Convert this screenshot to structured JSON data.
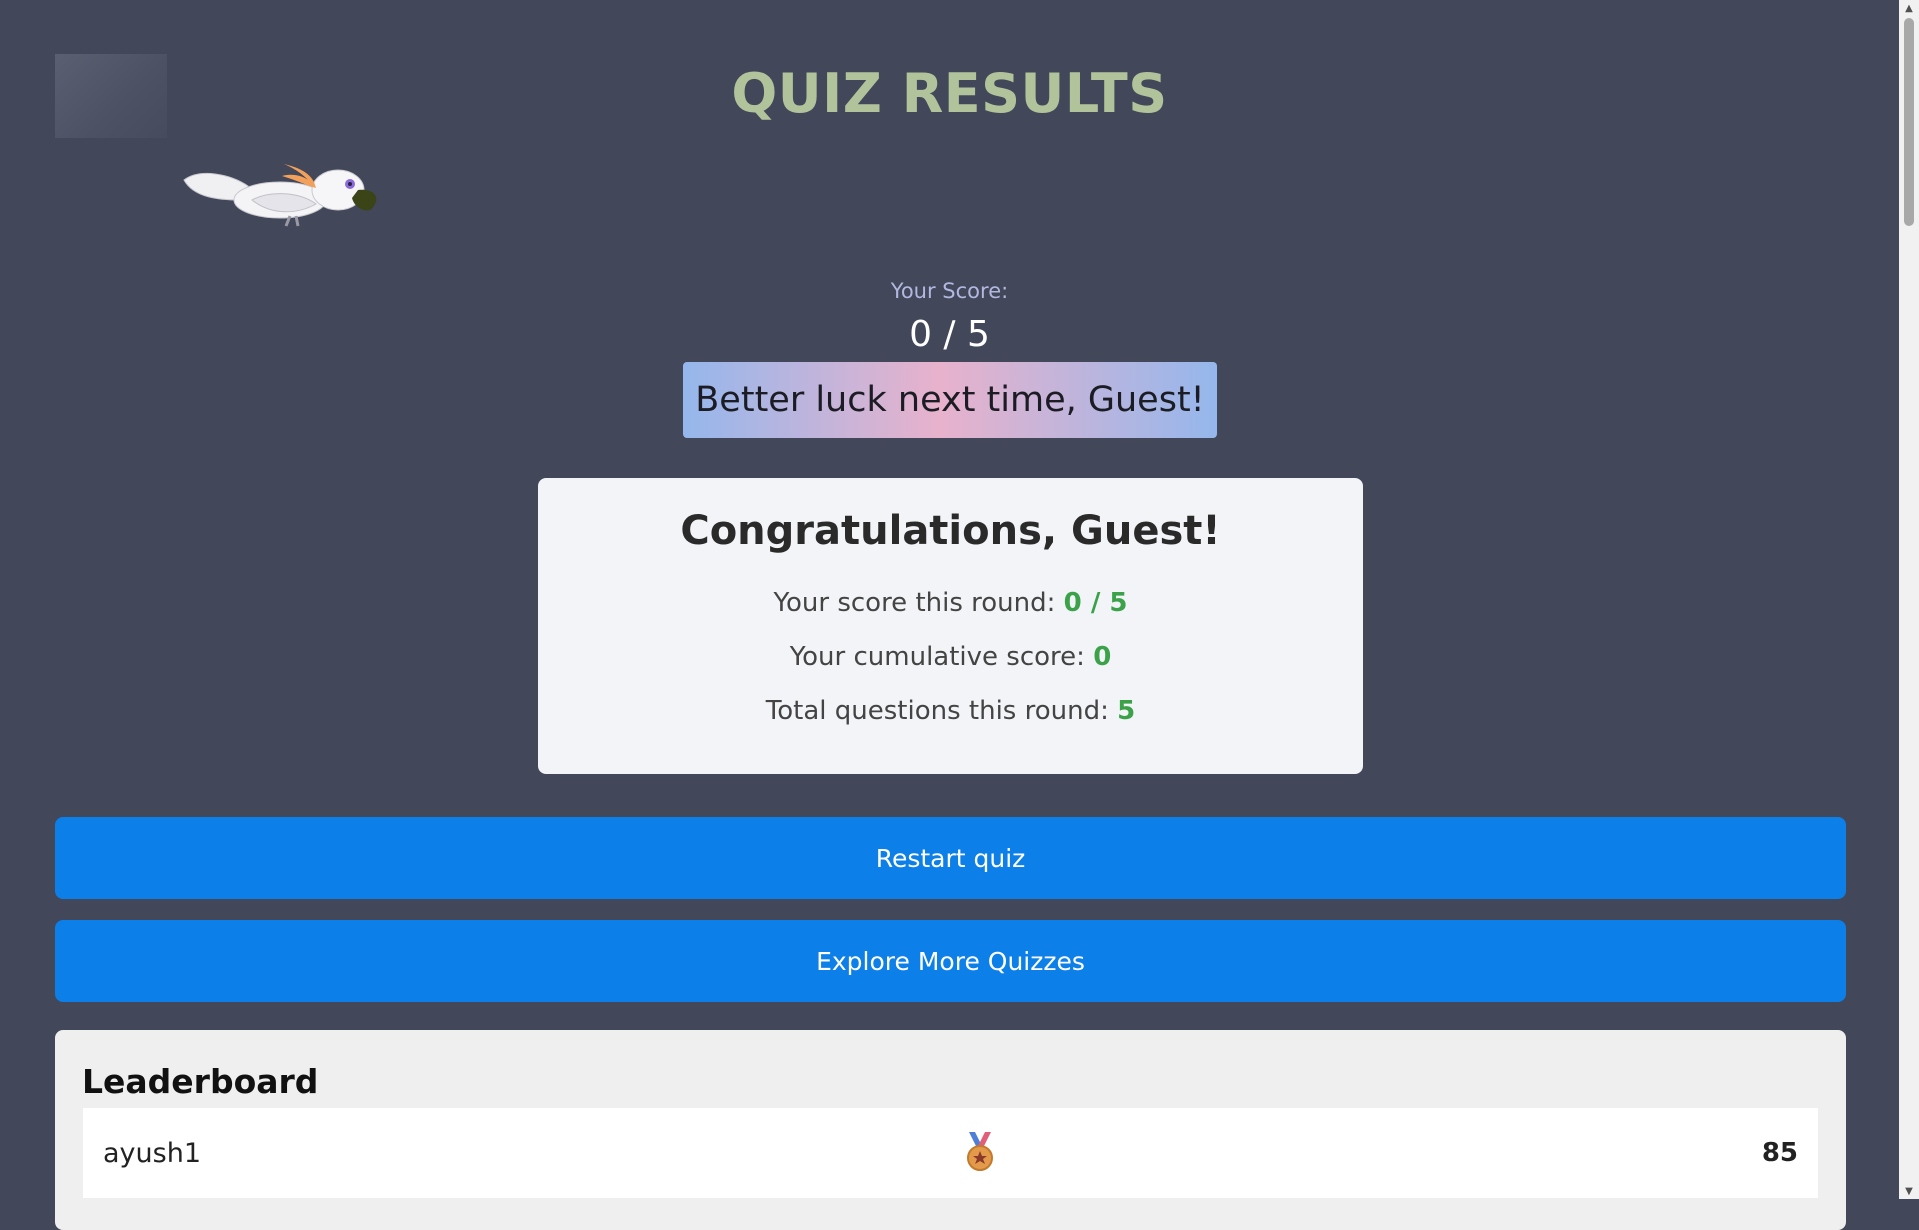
{
  "header": {
    "title": "QUIZ RESULTS"
  },
  "score": {
    "label": "Your Score:",
    "value": "0 / 5",
    "message": "Better luck next time, Guest!"
  },
  "summary": {
    "title": "Congratulations, Guest!",
    "round_label": "Your score this round: ",
    "round_value": "0 / 5",
    "cumulative_label": "Your cumulative score: ",
    "cumulative_value": "0",
    "total_label": "Total questions this round: ",
    "total_value": "5"
  },
  "buttons": {
    "restart": "Restart quiz",
    "explore": "Explore More Quizzes"
  },
  "leaderboard": {
    "title": "Leaderboard",
    "entries": [
      {
        "name": "ayush1",
        "medal": "medal-icon",
        "score": "85"
      }
    ]
  },
  "colors": {
    "background": "#424759",
    "title": "#b1c39a",
    "button": "#0c7fe8",
    "highlight": "#3ca24a"
  }
}
